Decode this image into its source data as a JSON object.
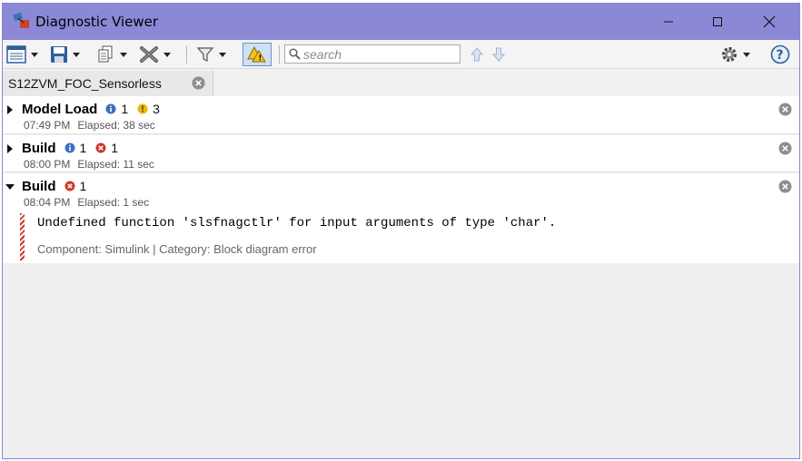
{
  "window": {
    "title": "Diagnostic Viewer",
    "icon": "matlab-simulink-icon"
  },
  "toolbar": {
    "items": [
      "report-view-icon",
      "save-icon",
      "copy-icon",
      "clear-icon",
      "filter-icon",
      "warning-filter-icon",
      "arrow-up-icon",
      "arrow-down-icon",
      "gear-icon",
      "help-icon"
    ],
    "search_placeholder": "search",
    "search_value": ""
  },
  "tabs": [
    {
      "label": "S12ZVM_FOC_Sensorless",
      "active": true
    }
  ],
  "entries": [
    {
      "title": "Model Load",
      "expanded": false,
      "info_count": "1",
      "warning_count": "3",
      "time": "07:49 PM",
      "elapsed": "Elapsed: 38 sec"
    },
    {
      "title": "Build",
      "expanded": false,
      "info_count": "1",
      "error_count": "1",
      "time": "08:00 PM",
      "elapsed": "Elapsed: 11 sec"
    },
    {
      "title": "Build",
      "expanded": true,
      "error_count": "1",
      "time": "08:04 PM",
      "elapsed": "Elapsed: 1 sec",
      "message": "Undefined function 'slsfnagctlr' for input arguments of type 'char'.",
      "meta": "Component:  Simulink | Category:  Block diagram error"
    }
  ],
  "colors": {
    "titlebar": "#8b88d6",
    "error": "#d2362b",
    "info": "#3a6fc4",
    "warning": "#e8b60c"
  }
}
